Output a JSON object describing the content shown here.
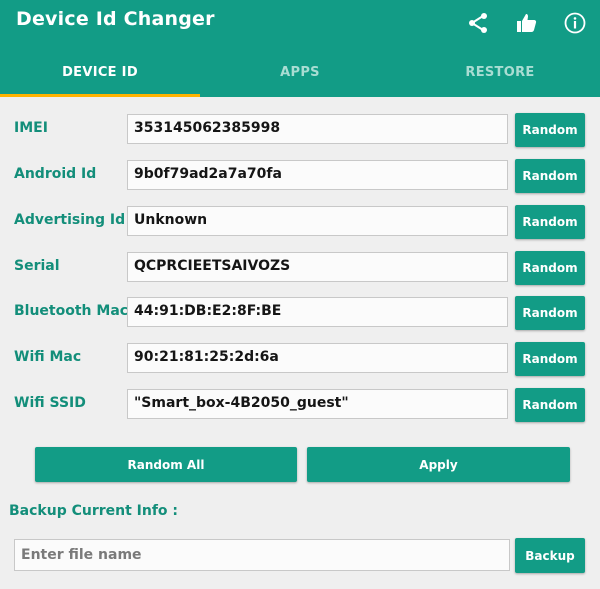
{
  "app_bar": {
    "title": "Device Id Changer",
    "actions": [
      "share-icon",
      "thumbs-up-icon",
      "info-icon"
    ]
  },
  "tabs": [
    {
      "label": "DEVICE ID",
      "active": true
    },
    {
      "label": "APPS",
      "active": false
    },
    {
      "label": "RESTORE",
      "active": false
    }
  ],
  "fields": [
    {
      "label": "IMEI",
      "value": "353145062385998"
    },
    {
      "label": "Android Id",
      "value": "9b0f79ad2a7a70fa"
    },
    {
      "label": "Advertising Id",
      "value": "Unknown"
    },
    {
      "label": "Serial",
      "value": "QCPRCIEETSAIVOZS"
    },
    {
      "label": "Bluetooth Mac",
      "value": "44:91:DB:E2:8F:BE"
    },
    {
      "label": "Wifi Mac",
      "value": "90:21:81:25:2d:6a"
    },
    {
      "label": "Wifi SSID",
      "value": "\"Smart_box-4B2050_guest\""
    }
  ],
  "random_button_label": "Random",
  "actions": {
    "random_all_label": "Random All",
    "apply_label": "Apply"
  },
  "backup": {
    "heading": "Backup Current Info :",
    "placeholder": "Enter file name",
    "button_label": "Backup"
  },
  "colors": {
    "primary": "#129c86",
    "accent": "#ffb300",
    "label_text": "#138e7a",
    "background": "#efefef"
  }
}
